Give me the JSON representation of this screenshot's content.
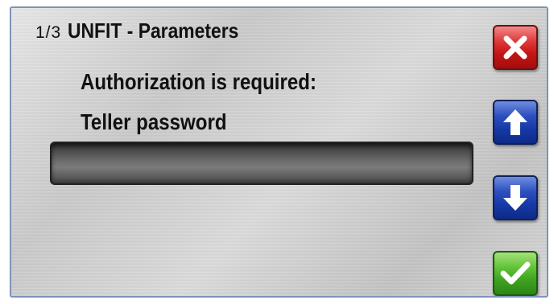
{
  "header": {
    "page_indicator": "1/3",
    "title": "UNFIT - Parameters"
  },
  "content": {
    "prompt": "Authorization is required:",
    "field_label": "Teller password",
    "password_value": ""
  },
  "buttons": [
    {
      "name": "close-button",
      "icon": "close-icon",
      "color": "#d42020"
    },
    {
      "name": "scroll-up-button",
      "icon": "arrow-up-icon",
      "color": "#1f43b4"
    },
    {
      "name": "scroll-down-button",
      "icon": "arrow-down-icon",
      "color": "#1f43b4"
    },
    {
      "name": "confirm-button",
      "icon": "checkmark-icon",
      "color": "#4aab2a"
    }
  ]
}
